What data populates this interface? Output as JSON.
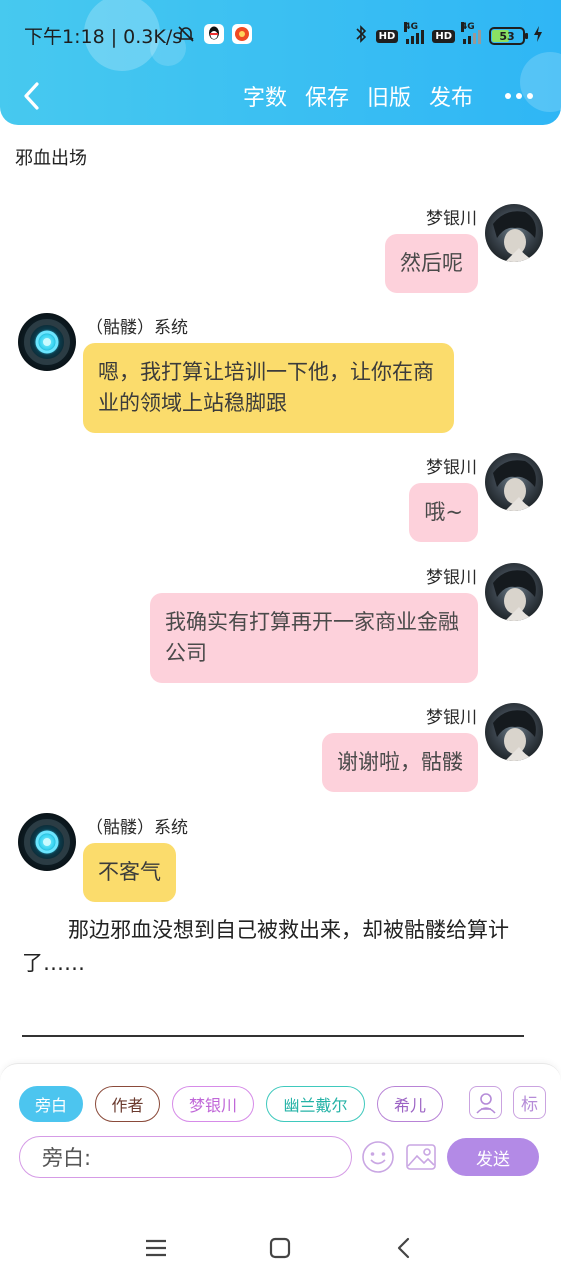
{
  "status_bar": {
    "time": "下午1:18",
    "speed": "0.3K/s",
    "network_label": "4G",
    "hd_label": "HD",
    "battery": "53"
  },
  "header": {
    "actions": [
      "字数",
      "保存",
      "旧版",
      "发布"
    ]
  },
  "chapter_title": "邪血出场",
  "messages": [
    {
      "speaker": "梦银川",
      "text": "然后呢",
      "side": "right",
      "color": "pink"
    },
    {
      "speaker": "（骷髅）系统",
      "text": "嗯，我打算让培训一下他，让你在商业的领域上站稳脚跟",
      "side": "left",
      "color": "yellow"
    },
    {
      "speaker": "梦银川",
      "text": "哦~",
      "side": "right",
      "color": "pink"
    },
    {
      "speaker": "梦银川",
      "text": "我确实有打算再开一家商业金融公司",
      "side": "right",
      "color": "pink"
    },
    {
      "speaker": "梦银川",
      "text": "谢谢啦，骷髅",
      "side": "right",
      "color": "pink"
    },
    {
      "speaker": "（骷髅）系统",
      "text": "不客气",
      "side": "left",
      "color": "yellow"
    }
  ],
  "narration": "那边邪血没想到自己被救出来，却被骷髅给算计了……",
  "toolbar": {
    "chips": [
      "旁白",
      "作者",
      "梦银川",
      "幽兰戴尔",
      "希儿"
    ],
    "tag_icon_label": "标",
    "input_value": "旁白:",
    "send_label": "发送"
  },
  "colors": {
    "header": "#2fb6f5",
    "pink_bubble": "#fdd1db",
    "yellow_bubble": "#fbdc6c",
    "send": "#b38ae6",
    "active_chip": "#4cc5ef"
  }
}
